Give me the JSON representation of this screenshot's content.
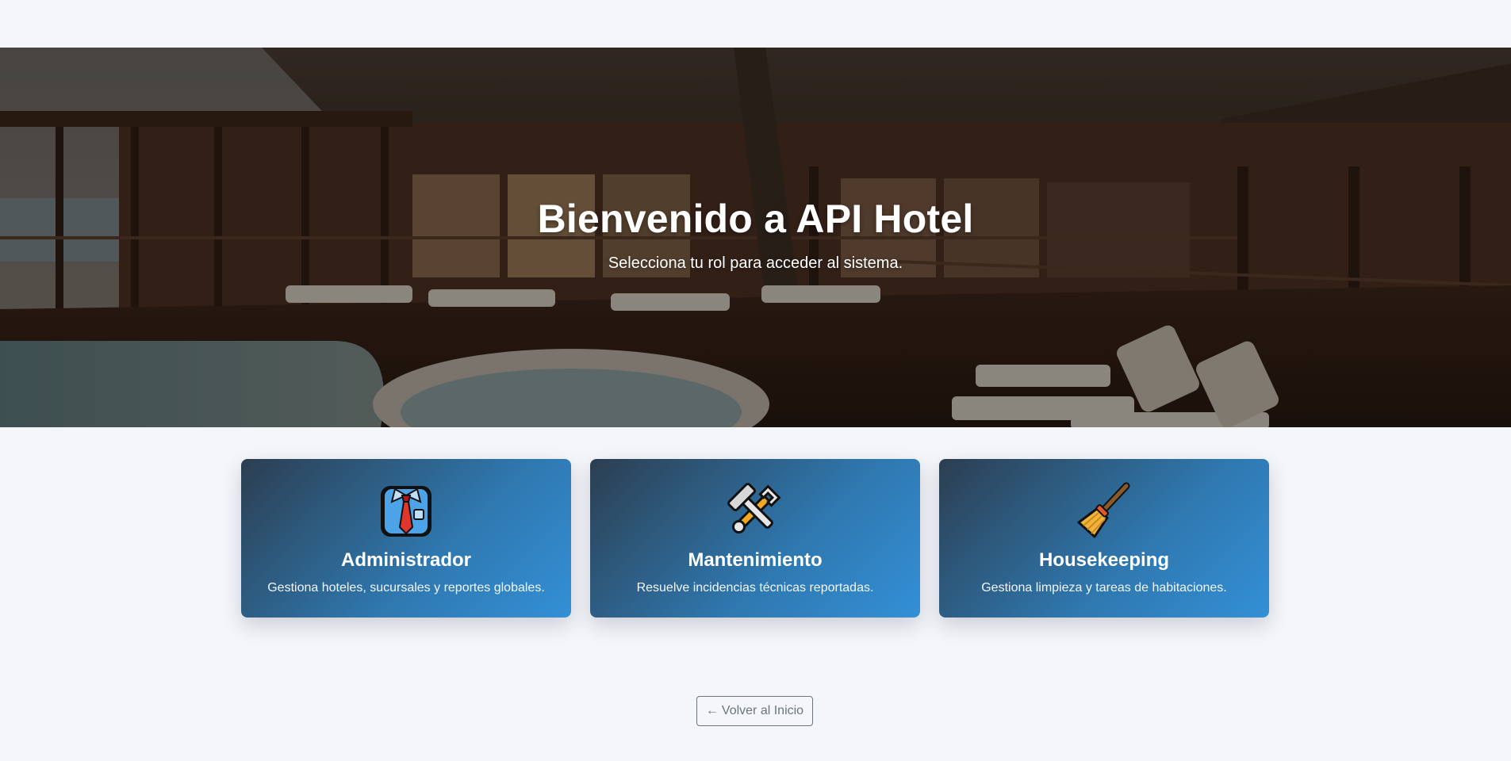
{
  "hero": {
    "title": "Bienvenido a API Hotel",
    "subtitle": "Selecciona tu rol para acceder al sistema."
  },
  "roles": [
    {
      "icon": "necktie-shirt-icon",
      "title": "Administrador",
      "description": "Gestiona hoteles, sucursales y reportes globales."
    },
    {
      "icon": "hammer-and-wrench-icon",
      "title": "Mantenimiento",
      "description": "Resuelve incidencias técnicas reportadas."
    },
    {
      "icon": "broom-icon",
      "title": "Housekeeping",
      "description": "Gestiona limpieza y tareas de habitaciones."
    }
  ],
  "back_button": {
    "arrow": "←",
    "label": "Volver al Inicio"
  },
  "colors": {
    "page_background": "#f4f6fa",
    "card_gradient_start": "#2c3e50",
    "card_gradient_end": "#3390d6",
    "back_button_border": "#6c757d"
  }
}
